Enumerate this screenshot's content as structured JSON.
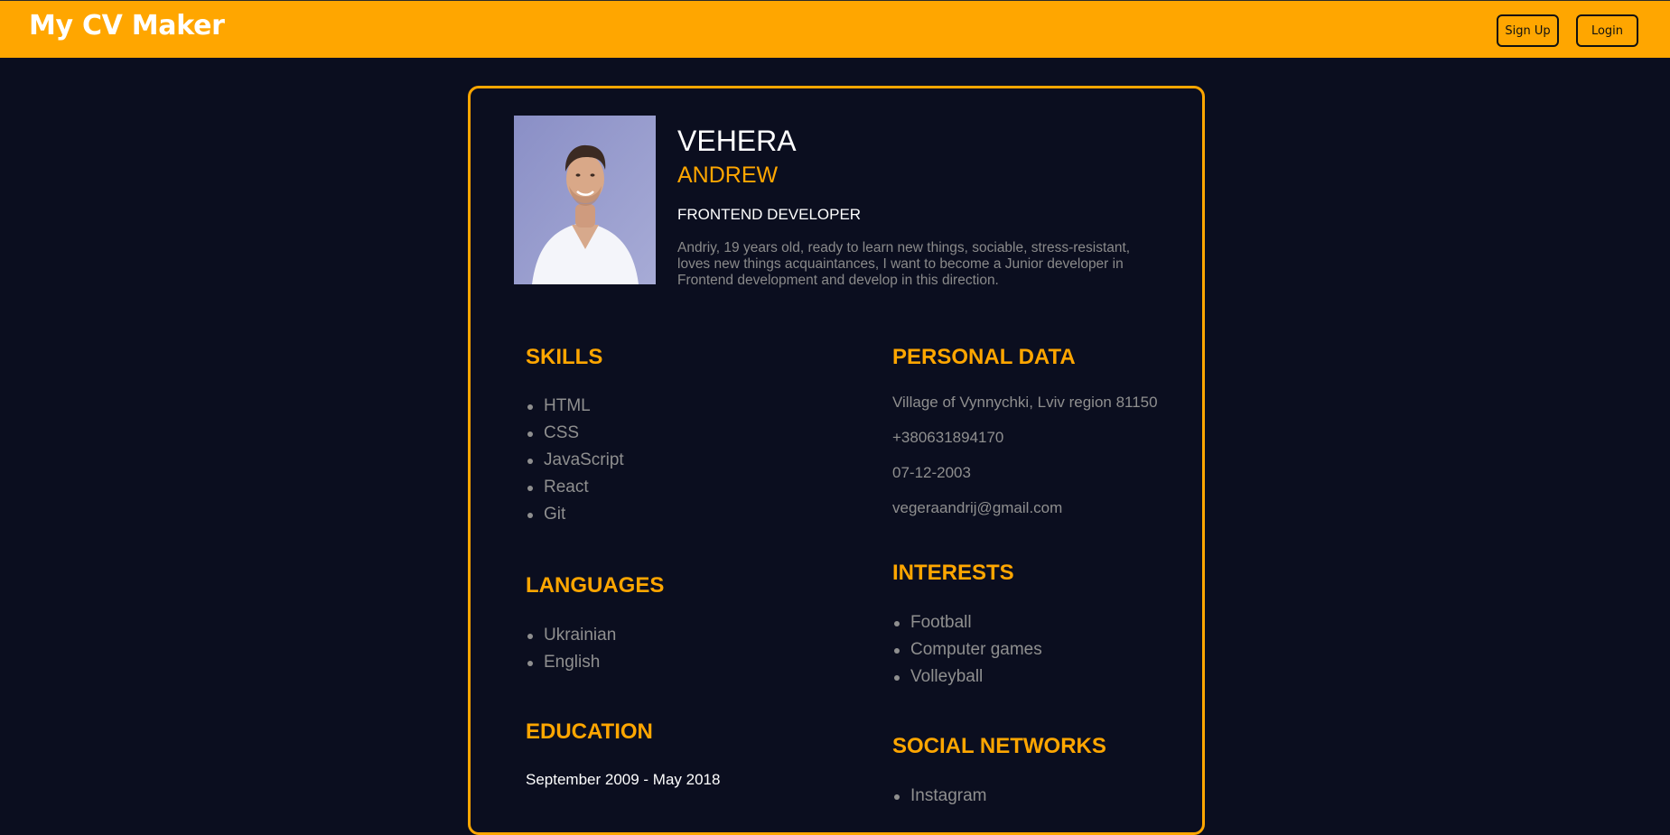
{
  "header": {
    "brand": "My CV Maker",
    "signup_label": "Sign Up",
    "login_label": "Login"
  },
  "profile": {
    "last_name": "VEHERA",
    "first_name": "ANDREW",
    "title": "FRONTEND DEVELOPER",
    "about": "Andriy, 19 years old, ready to learn new things, sociable, stress-resistant, loves new things acquaintances, I want to become a Junior developer in Frontend development and develop in this direction."
  },
  "skills": {
    "heading": "SKILLS",
    "items": [
      "HTML",
      "CSS",
      "JavaScript",
      "React",
      "Git"
    ]
  },
  "languages": {
    "heading": "LANGUAGES",
    "items": [
      "Ukrainian",
      "English"
    ]
  },
  "education": {
    "heading": "EDUCATION",
    "period": "September 2009 - May 2018"
  },
  "personal_data": {
    "heading": "PERSONAL DATA",
    "address": "Village of Vynnychki, Lviv region 81150",
    "phone": "+380631894170",
    "birthdate": "07-12-2003",
    "email": "vegeraandrij@gmail.com"
  },
  "interests": {
    "heading": "INTERESTS",
    "items": [
      "Football",
      "Computer games",
      "Volleyball"
    ]
  },
  "social_networks": {
    "heading": "SOCIAL NETWORKS",
    "items": [
      "Instagram"
    ]
  },
  "colors": {
    "accent": "#ffa600",
    "background": "#0b0e1f",
    "muted_text": "#8f8f8f"
  }
}
